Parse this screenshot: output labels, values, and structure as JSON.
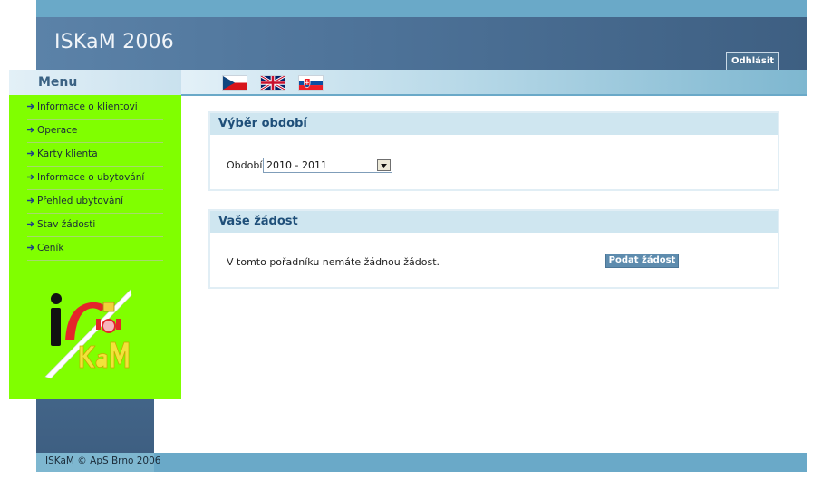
{
  "header": {
    "app_title": "ISKaM 2006",
    "logout_label": "Odhlásit"
  },
  "languages": [
    {
      "icon": "czech-flag-icon",
      "colors": [
        "#ffffff",
        "#d7141a",
        "#11457e"
      ]
    },
    {
      "icon": "uk-flag-icon",
      "colors": [
        "#012169",
        "#ffffff",
        "#c8102e"
      ]
    },
    {
      "icon": "slovak-flag-icon",
      "colors": [
        "#ffffff",
        "#0b4ea2",
        "#ee1c25"
      ]
    }
  ],
  "sidebar": {
    "title": "Menu",
    "items": [
      {
        "label": "Informace o klientovi"
      },
      {
        "label": "Operace"
      },
      {
        "label": "Karty klienta"
      },
      {
        "label": "Informace o ubytování"
      },
      {
        "label": "Přehled ubytování"
      },
      {
        "label": "Stav žádosti"
      },
      {
        "label": "Ceník"
      }
    ],
    "logo_icon": "iskam-logo-icon"
  },
  "period_panel": {
    "title": "Výběr období",
    "field_label": "Období:",
    "selected_value": "2010 - 2011"
  },
  "request_panel": {
    "title": "Vaše žádost",
    "message": "V tomto pořadníku nemáte žádnou žádost.",
    "submit_label": "Podat žádost"
  },
  "footer": {
    "text": "ISKaM © ApS Brno 2006"
  },
  "colors": {
    "header_blue": "#4d7298",
    "accent_light_blue": "#6aa9c8",
    "sidebar_green": "#80ff00",
    "panel_head": "#cfe6f0",
    "panel_title": "#1f4f79"
  }
}
